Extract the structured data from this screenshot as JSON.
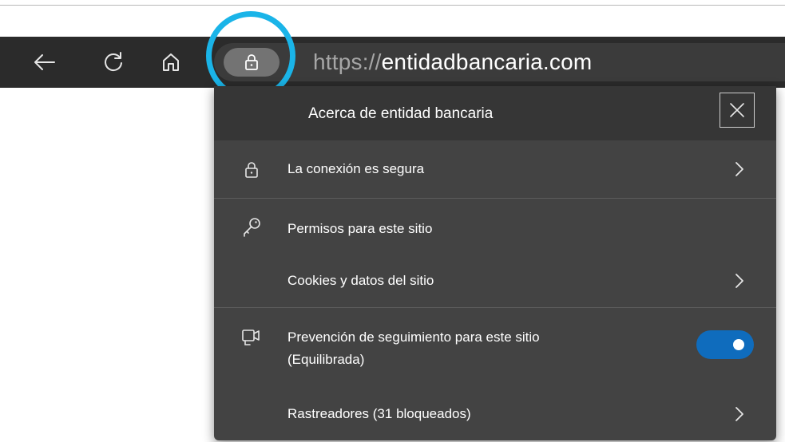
{
  "toolbar": {
    "back_icon": "back-arrow-icon",
    "refresh_icon": "refresh-icon",
    "home_icon": "home-icon",
    "lock_icon": "lock-icon",
    "url_scheme": "https://",
    "url_host": "entidadbancaria.com"
  },
  "popup": {
    "title": "Acerca de entidad bancaria",
    "close_icon": "close-icon",
    "connection": {
      "icon": "lock-icon",
      "label": "La conexión es segura"
    },
    "permissions": {
      "icon": "key-icon",
      "label": "Permisos para este sitio"
    },
    "cookies": {
      "label": "Cookies y datos del sitio"
    },
    "tracking": {
      "icon": "tracking-prevention-icon",
      "label_line1": "Prevención de seguimiento para este sitio",
      "label_line2": "(Equilibrada)",
      "toggle_on": true
    },
    "trackers": {
      "label": "Rastreadores (31 bloqueados)"
    }
  },
  "colors": {
    "highlight_ring": "#1ab4e8",
    "toggle_on": "#0f6cbd",
    "toolbar_bg": "#2b2b2b",
    "popup_bg": "#434343"
  }
}
